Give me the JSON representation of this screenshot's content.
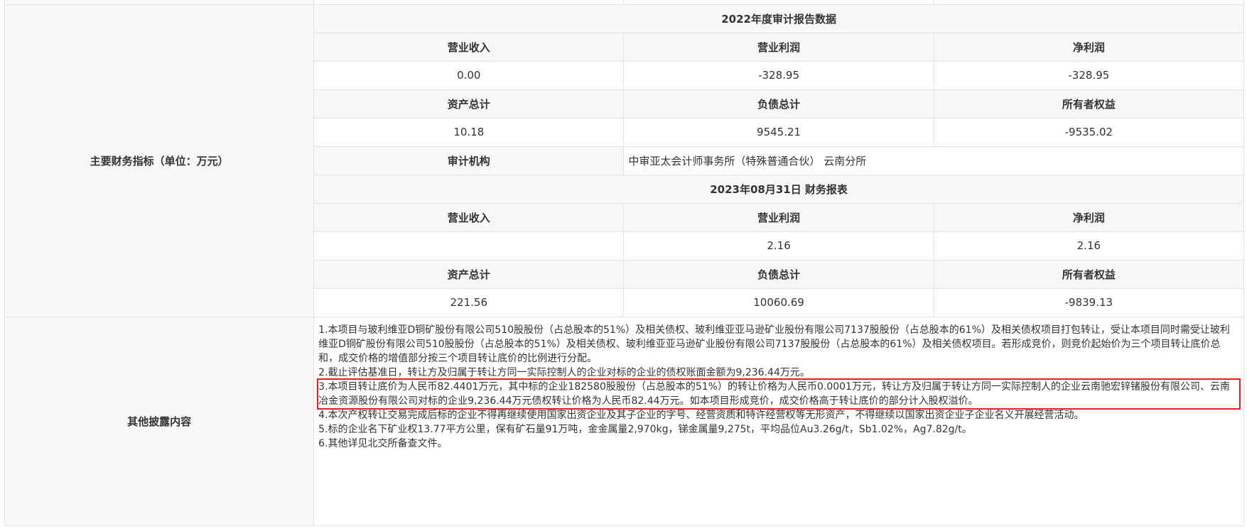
{
  "financial": {
    "label": "主要财务指标（单位：万元）",
    "audit2022": {
      "title": "2022年度审计报告数据",
      "h1": [
        "营业收入",
        "营业利润",
        "净利润"
      ],
      "v1": [
        "0.00",
        "-328.95",
        "-328.95"
      ],
      "h2": [
        "资产总计",
        "负债总计",
        "所有者权益"
      ],
      "v2": [
        "10.18",
        "9545.21",
        "-9535.02"
      ],
      "auditor_label": "审计机构",
      "auditor_value": "中审亚太会计师事务所（特殊普通合伙） 云南分所"
    },
    "report2023": {
      "title": "2023年08月31日 财务报表",
      "h1": [
        "营业收入",
        "营业利润",
        "净利润"
      ],
      "v1": [
        "",
        "2.16",
        "2.16"
      ],
      "h2": [
        "资产总计",
        "负债总计",
        "所有者权益"
      ],
      "v2": [
        "221.56",
        "10060.69",
        "-9839.13"
      ]
    }
  },
  "disclosure": {
    "label": "其他披露内容",
    "items": [
      "1.本项目与玻利维亚D铜矿股份有限公司510股股份（占总股本的51%）及相关债权、玻利维亚亚马逊矿业股份有限公司7137股股份（占总股本的61%）及相关债权项目打包转让，受让本项目同时需受让玻利维亚D铜矿股份有限公司510股股份（占总股本的51%）及相关债权、玻利维亚亚马逊矿业股份有限公司7137股股份（占总股本的61%）及相关债权项目。若形成竞价，则竞价起始价为三个项目转让底价总和，成交价格的增值部分按三个项目转让底价的比例进行分配。",
      "2.截止评估基准日，转让方及归属于转让方同一实际控制人的企业对标的企业的债权账面金额为9,236.44万元。",
      "3.本项目转让底价为人民币82.4401万元，其中标的企业182580股股份（占总股本的51%）的转让价格为人民币0.0001万元，转让方及归属于转让方同一实际控制人的企业云南驰宏锌锗股份有限公司、云南冶金资源股份有限公司对标的企业9,236.44万元债权转让价格为人民币82.44万元。如本项目形成竞价，成交价格高于转让底价的部分计入股权溢价。",
      "4.本次产权转让交易完成后标的企业不得再继续使用国家出资企业及其子企业的字号、经营资质和特许经营权等无形资产，不得继续以国家出资企业子企业名义开展经营活动。",
      "5.标的企业名下矿业权13.77平方公里，保有矿石量91万吨，金金属量2,970kg，锑金属量9,275t，平均品位Au3.26g/t，Sb1.02%，Ag7.82g/t。",
      "6.其他详见北交所备查文件。"
    ],
    "highlight_color": "#e02020"
  }
}
